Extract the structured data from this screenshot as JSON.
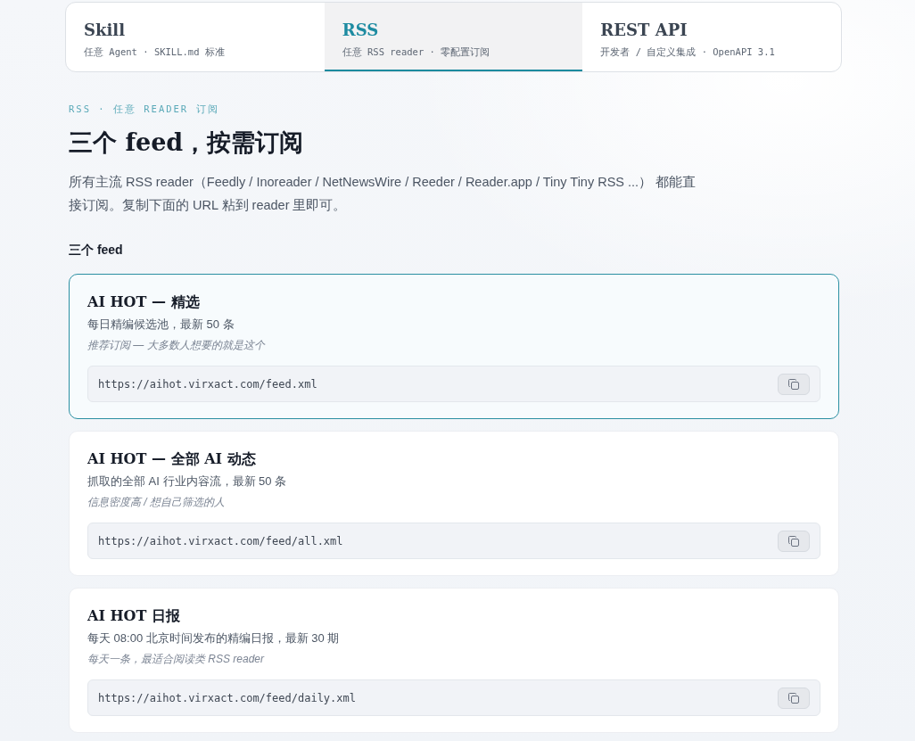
{
  "tabs": [
    {
      "title": "Skill",
      "subtitle": "任意 Agent · SKILL.md 标准",
      "selected": false
    },
    {
      "title": "RSS",
      "subtitle": "任意 RSS reader · 零配置订阅",
      "selected": true
    },
    {
      "title": "REST API",
      "subtitle": "开发者 / 自定义集成 · OpenAPI 3.1",
      "selected": false
    }
  ],
  "section": {
    "eyebrow": "RSS · 任意 READER 订阅",
    "heading": "三个 feed，按需订阅",
    "intro": "所有主流 RSS reader（Feedly / Inoreader / NetNewsWire / Reeder / Reader.app / Tiny Tiny RSS ...） 都能直接订阅。复制下面的 URL 粘到 reader 里即可。",
    "subheading": "三个 feed"
  },
  "feeds": [
    {
      "title": "AI HOT — 精选",
      "description": "每日精编候选池，最新 50 条",
      "note": "推荐订阅 — 大多数人想要的就是这个",
      "url": "https://aihot.virxact.com/feed.xml",
      "highlighted": true
    },
    {
      "title": "AI HOT — 全部 AI 动态",
      "description": "抓取的全部 AI 行业内容流，最新 50 条",
      "note": "信息密度高 / 想自己筛选的人",
      "url": "https://aihot.virxact.com/feed/all.xml",
      "highlighted": false
    },
    {
      "title": "AI HOT 日报",
      "description": "每天 08:00 北京时间发布的精编日报，最新 30 期",
      "note": "每天一条，最适合阅读类 RSS reader",
      "url": "https://aihot.virxact.com/feed/daily.xml",
      "highlighted": false
    }
  ]
}
